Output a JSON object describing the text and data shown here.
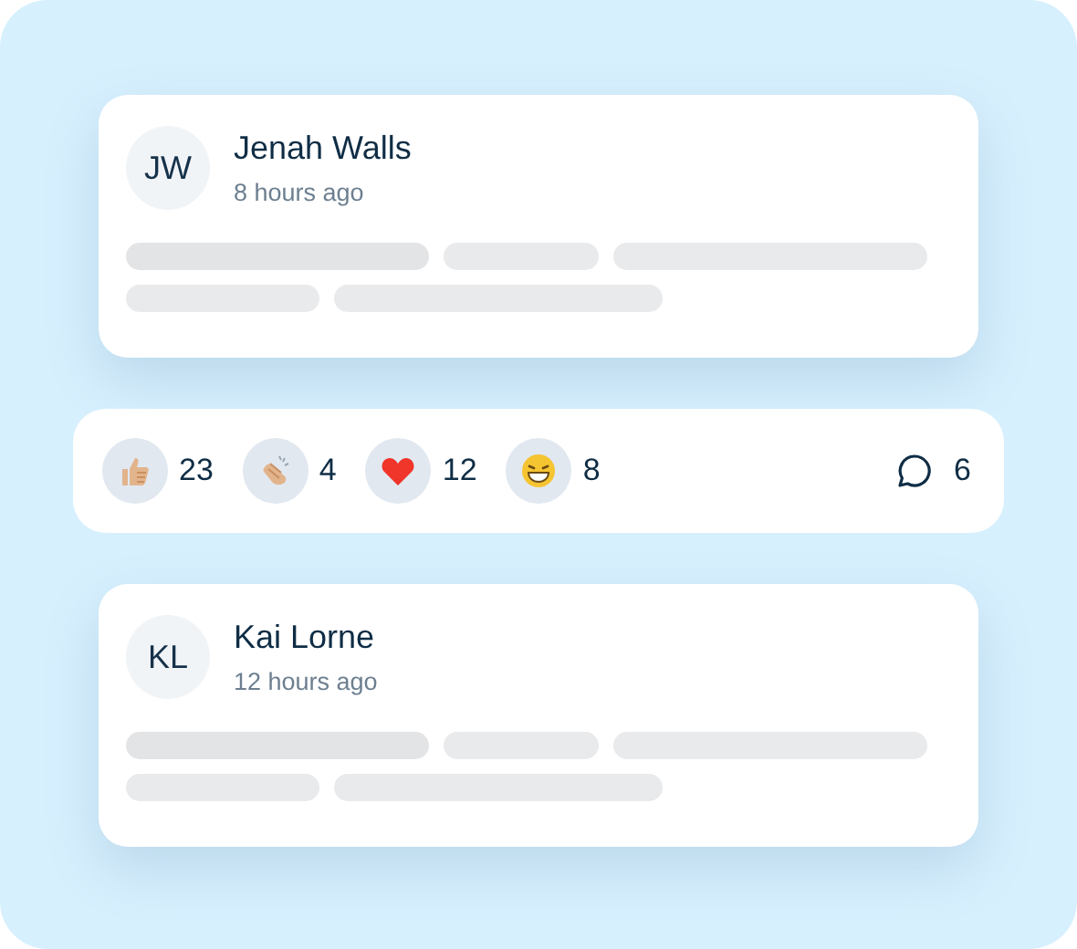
{
  "posts": [
    {
      "initials": "JW",
      "name": "Jenah Walls",
      "time": "8 hours ago"
    },
    {
      "initials": "KL",
      "name": "Kai Lorne",
      "time": "12 hours ago"
    }
  ],
  "reactions": [
    {
      "kind": "thumbs",
      "count": "23"
    },
    {
      "kind": "clap",
      "count": "4"
    },
    {
      "kind": "heart",
      "count": "12"
    },
    {
      "kind": "grin",
      "count": "8"
    }
  ],
  "comments": {
    "count": "6"
  }
}
